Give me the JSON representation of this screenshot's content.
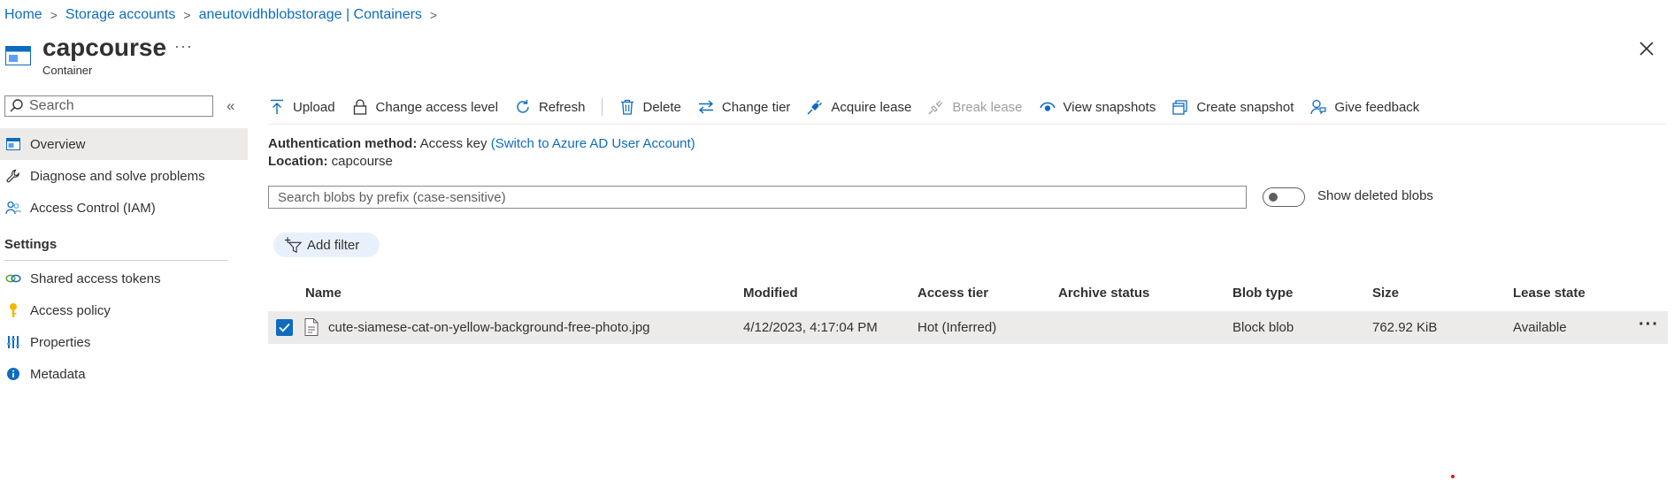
{
  "breadcrumb": [
    "Home",
    "Storage accounts",
    "aneutovidhblobstorage | Containers"
  ],
  "header": {
    "title": "capcourse",
    "subtitle": "Container",
    "more_label": "···"
  },
  "nav": {
    "search_placeholder": "Search",
    "collapse_label": "«",
    "items_top": [
      {
        "label": "Overview",
        "icon": "container-icon",
        "active": true
      },
      {
        "label": "Diagnose and solve problems",
        "icon": "wrench-icon"
      },
      {
        "label": "Access Control (IAM)",
        "icon": "people-icon"
      }
    ],
    "settings_title": "Settings",
    "items_settings": [
      {
        "label": "Shared access tokens",
        "icon": "link-icon"
      },
      {
        "label": "Access policy",
        "icon": "key-icon"
      },
      {
        "label": "Properties",
        "icon": "properties-icon"
      },
      {
        "label": "Metadata",
        "icon": "info-icon"
      }
    ]
  },
  "toolbar": {
    "upload": "Upload",
    "change_access": "Change access level",
    "refresh": "Refresh",
    "delete": "Delete",
    "change_tier": "Change tier",
    "acquire_lease": "Acquire lease",
    "break_lease": "Break lease",
    "view_snapshots": "View snapshots",
    "create_snapshot": "Create snapshot",
    "give_feedback": "Give feedback"
  },
  "info": {
    "auth_label": "Authentication method:",
    "auth_value": "Access key",
    "auth_link": "(Switch to Azure AD User Account)",
    "location_label": "Location:",
    "location_value": "capcourse"
  },
  "blob_search": {
    "placeholder": "Search blobs by prefix (case-sensitive)"
  },
  "show_deleted": {
    "label": "Show deleted blobs",
    "on": false
  },
  "filter": {
    "label": "Add filter"
  },
  "table": {
    "columns": [
      "Name",
      "Modified",
      "Access tier",
      "Archive status",
      "Blob type",
      "Size",
      "Lease state"
    ],
    "rows": [
      {
        "selected": true,
        "name": "cute-siamese-cat-on-yellow-background-free-photo.jpg",
        "modified": "4/12/2023, 4:17:04 PM",
        "access_tier": "Hot (Inferred)",
        "archive_status": "",
        "blob_type": "Block blob",
        "size": "762.92 KiB",
        "lease_state": "Available",
        "more_label": "···"
      }
    ]
  },
  "colors": {
    "accent": "#0f6cbd",
    "row_selected_bg": "#edebe9"
  }
}
